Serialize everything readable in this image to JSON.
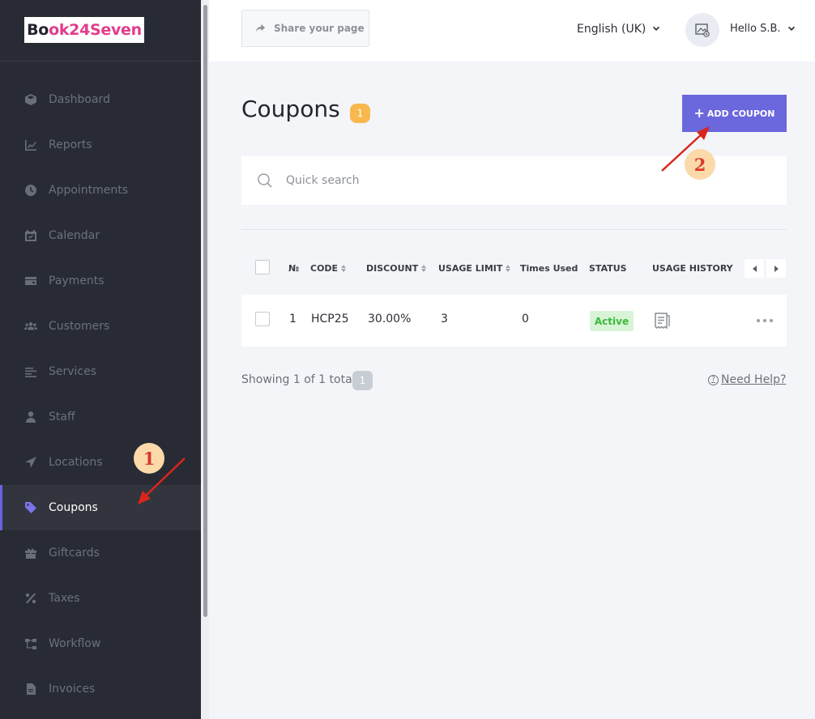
{
  "logo": {
    "part1": "Bo",
    "part2": "ok24Seven"
  },
  "sidebar": {
    "items": [
      {
        "label": "Dashboard",
        "icon": "cube-icon"
      },
      {
        "label": "Reports",
        "icon": "chart-line-icon"
      },
      {
        "label": "Appointments",
        "icon": "clock-icon"
      },
      {
        "label": "Calendar",
        "icon": "calendar-icon"
      },
      {
        "label": "Payments",
        "icon": "wallet-icon"
      },
      {
        "label": "Customers",
        "icon": "users-icon"
      },
      {
        "label": "Services",
        "icon": "list-icon"
      },
      {
        "label": "Staff",
        "icon": "user-icon"
      },
      {
        "label": "Locations",
        "icon": "location-arrow-icon"
      },
      {
        "label": "Coupons",
        "icon": "tag-icon",
        "active": true
      },
      {
        "label": "Giftcards",
        "icon": "gift-icon"
      },
      {
        "label": "Taxes",
        "icon": "percent-icon"
      },
      {
        "label": "Workflow",
        "icon": "workflow-icon"
      },
      {
        "label": "Invoices",
        "icon": "document-icon"
      }
    ]
  },
  "topbar": {
    "share_label": "Share your page",
    "language": "English (UK)",
    "user_greeting": "Hello S.B."
  },
  "page": {
    "title": "Coupons",
    "count": "1",
    "add_button": "ADD COUPON",
    "plus": "+"
  },
  "search": {
    "placeholder": "Quick search"
  },
  "table": {
    "columns": {
      "number": "№",
      "code": "CODE",
      "discount": "DISCOUNT",
      "usage_limit": "USAGE LIMIT",
      "times_used": "Times Used",
      "status": "STATUS",
      "usage_history": "USAGE HISTORY"
    },
    "rows": [
      {
        "number": "1",
        "code": "HCP25",
        "discount": "30.00%",
        "usage_limit": "3",
        "times_used": "0",
        "status": "Active"
      }
    ]
  },
  "footer": {
    "showing": "Showing 1 of 1 total",
    "total": "1",
    "help_q": "?",
    "help": "Need Help?"
  },
  "annotations": {
    "step1": "1",
    "step2": "2"
  },
  "colors": {
    "accent": "#6b67dc",
    "sidebar_bg": "#282b33",
    "badge": "#f8b84e",
    "status_active": "#3eb73e",
    "annotation_arrow": "#d9261c"
  }
}
